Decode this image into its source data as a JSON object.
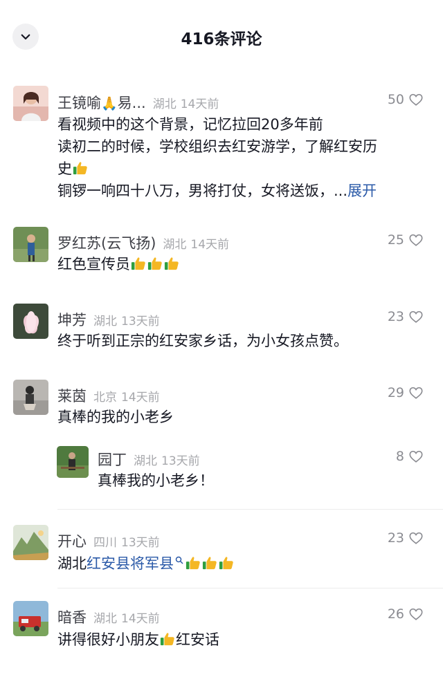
{
  "header": {
    "title": "416条评论"
  },
  "colors": {
    "text": "#161823",
    "meta": "#a6a7ab",
    "link": "#2b5aa8"
  },
  "comments": [
    {
      "name": "王镜�india🙏易...",
      "location": "湖北",
      "time": "14天前",
      "likes": "50",
      "lines": [
        "看视频中的这个背景，记忆拉回20多年前",
        "读初二的时候，学校组织去红安游学，了解红安历",
        "史"
      ],
      "line4": "铜锣一响四十八万，男将打仗，女将送饭，...",
      "expand": "展开"
    },
    {
      "name": "罗红苏(云飞扬)",
      "location": "湖北",
      "time": "14天前",
      "likes": "25",
      "text": "红色宣传员"
    },
    {
      "name": "坤芳",
      "location": "湖北",
      "time": "13天前",
      "likes": "23",
      "text": "终于听到正宗的红安家乡话，为小女孩点赞。"
    },
    {
      "name": "莱茵",
      "location": "北京",
      "time": "14天前",
      "likes": "29",
      "text": "真棒的我的小老乡",
      "reply": {
        "name": "园丁",
        "location": "湖北",
        "time": "13天前",
        "likes": "8",
        "text": "真棒我的小老乡！"
      }
    },
    {
      "name": "开心",
      "location": "四川",
      "time": "13天前",
      "likes": "23",
      "text_prefix": "湖北",
      "text_link": "红安县将军县"
    },
    {
      "name": "暗香",
      "location": "湖北",
      "time": "14天前",
      "likes": "26",
      "text_a": "讲得很好小朋友",
      "text_b": "红安话"
    }
  ]
}
